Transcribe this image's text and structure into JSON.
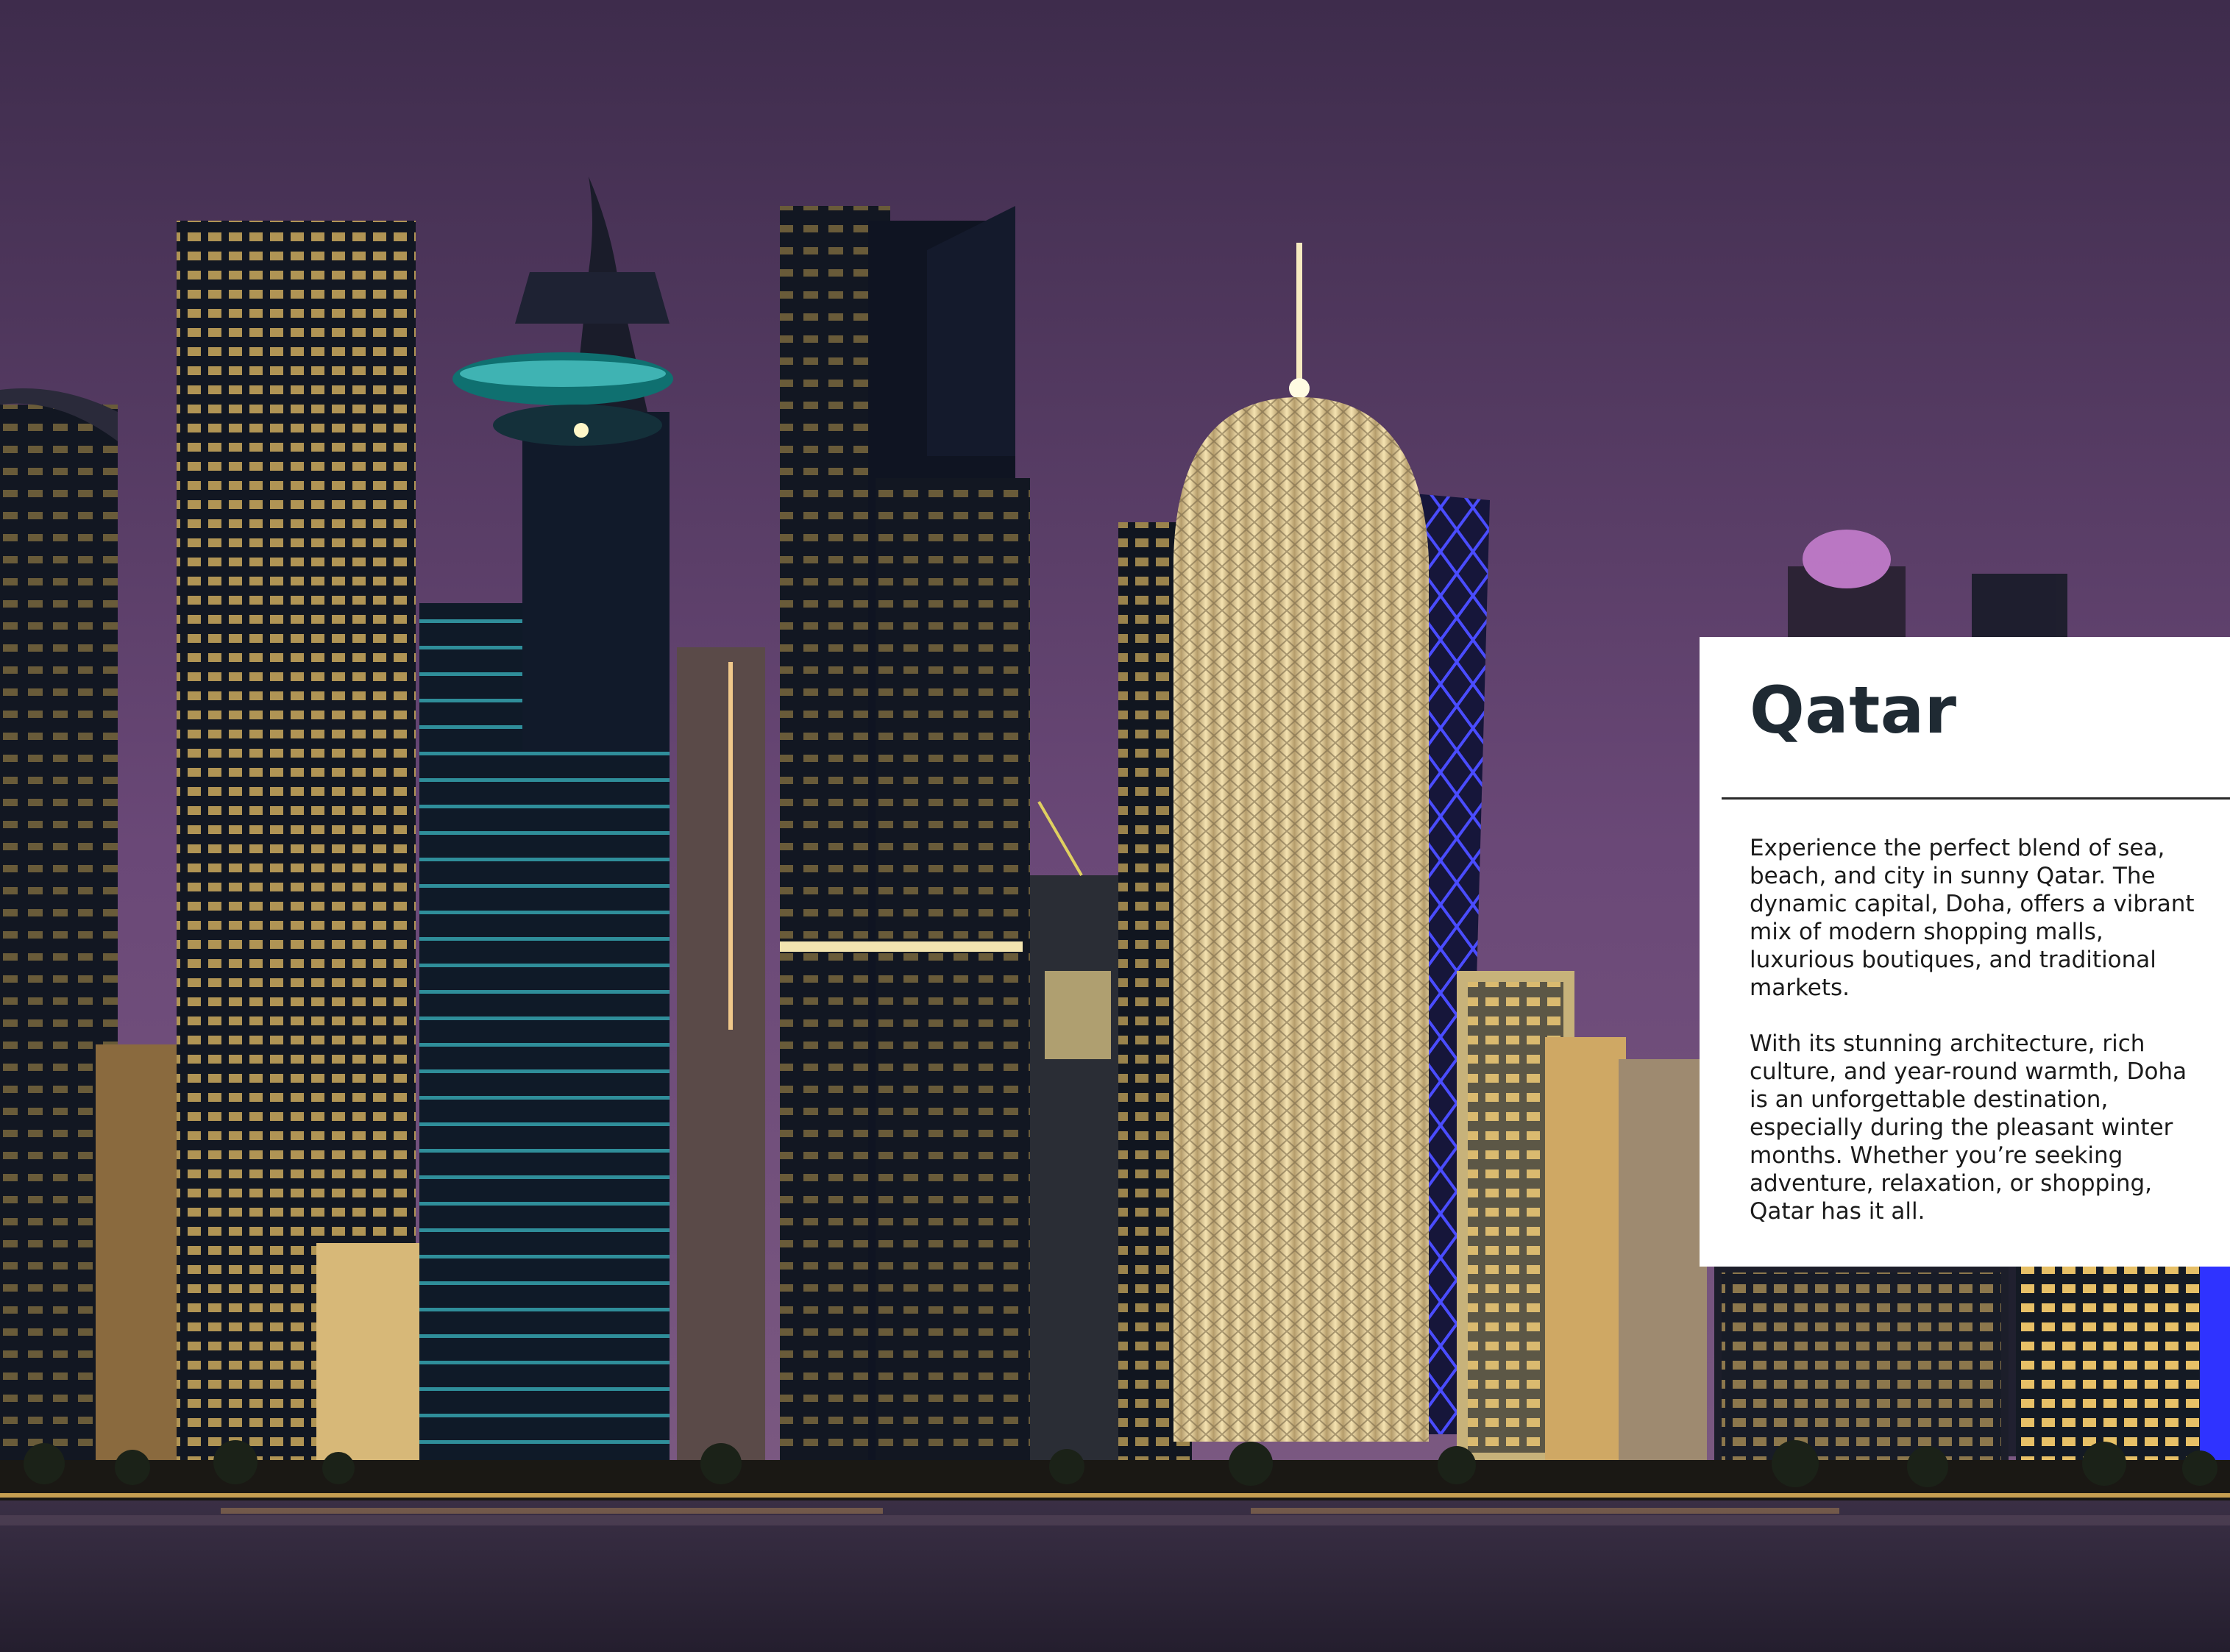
{
  "card": {
    "title": "Qatar",
    "paragraphs": [
      "Experience the perfect blend of sea, beach, and city in sunny Qatar. The dynamic capital, Doha, offers a vibrant mix of modern shopping malls, luxurious boutiques, and traditional markets.",
      "With its stunning architecture, rich culture, and year-round warmth, Doha is an unforgettable destination, especially during the pleasant winter months. Whether you’re seeking adventure, relaxation, or shopping, Qatar has it all."
    ]
  },
  "colors": {
    "sky_top": "#4a3358",
    "sky_bottom": "#6b4a78",
    "water": "#2e2838",
    "card_background": "#ffffff",
    "title_color": "#1f2a33"
  }
}
